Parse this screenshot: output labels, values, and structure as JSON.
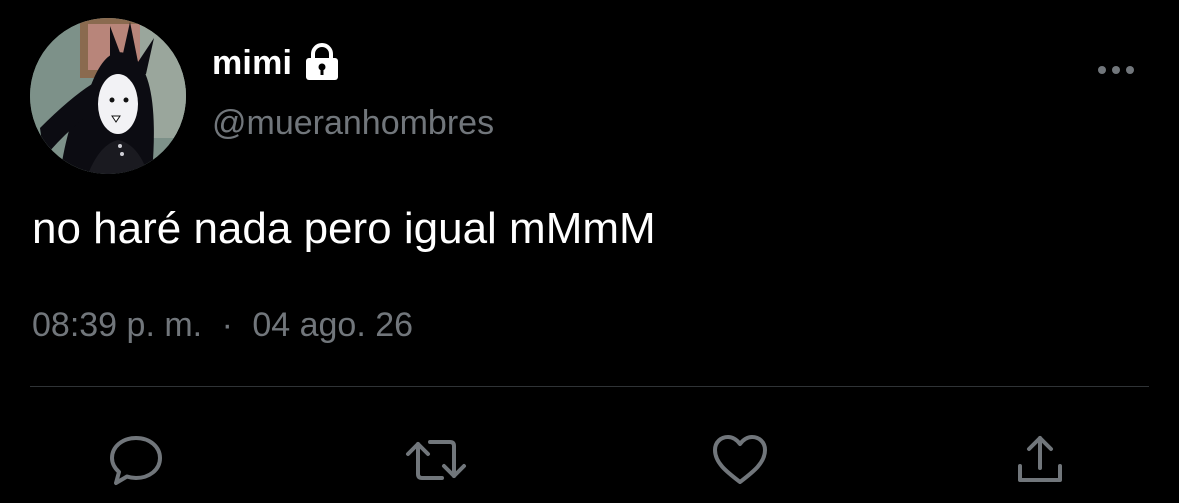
{
  "tweet": {
    "display_name": "mimi",
    "handle": "@mueranhombres",
    "text": "no haré nada pero igual mMmM",
    "time": "08:39 p. m.",
    "separator": "·",
    "date": "04 ago. 26"
  },
  "icons": {
    "protected": "lock-icon",
    "more": "more-horizontal-icon",
    "reply": "reply-bubble-icon",
    "retweet": "retweet-arrows-icon",
    "like": "heart-icon",
    "share": "share-upload-icon"
  },
  "colors": {
    "background": "#000000",
    "primary_text": "#ffffff",
    "secondary_text": "#71767b",
    "divider": "#2f3336",
    "icon": "#71767b"
  }
}
